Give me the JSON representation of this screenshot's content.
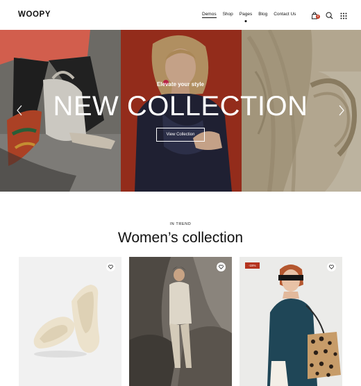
{
  "header": {
    "logo": "WOOPY",
    "nav": [
      {
        "label": "Demos"
      },
      {
        "label": "Shop"
      },
      {
        "label": "Pages"
      },
      {
        "label": "Blog"
      },
      {
        "label": "Contact Us"
      }
    ],
    "cart_count": "0",
    "icons": [
      "bag-icon",
      "search-icon",
      "grid-menu-icon"
    ]
  },
  "hero": {
    "subtitle": "Elevate your style",
    "title": "NEW COLLECTION",
    "button_label": "View Collection",
    "accent_color": "#a8331f"
  },
  "section": {
    "eyebrow": "IN TREND",
    "title": "Women’s collection"
  },
  "products": [
    {
      "image": "cream-flat-shoes"
    },
    {
      "image": "woman-in-rocky-cave"
    },
    {
      "image": "woman-with-leopard-tote",
      "badge": "-15%"
    }
  ],
  "colors": {
    "badge": "#b5341f",
    "cart_badge": "#c2361e"
  }
}
